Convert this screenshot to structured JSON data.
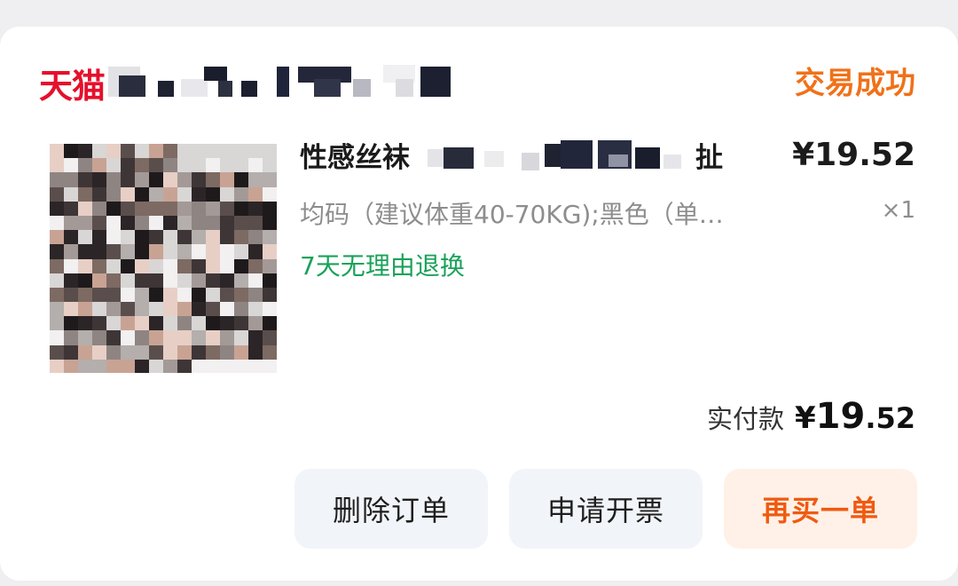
{
  "order": {
    "shop_brand": "天猫",
    "status": "交易成功",
    "item": {
      "title_start": "性感丝袜",
      "title_end": "扯",
      "price": "¥19.52",
      "spec": "均码（建议体重40-70KG);黑色（单…",
      "quantity": "×1",
      "service_tag": "7天无理由退换"
    },
    "payment": {
      "label": "实付款",
      "currency": "¥",
      "amount_integer": "19",
      "amount_decimal": ".52"
    },
    "actions": {
      "delete_label": "删除订单",
      "invoice_label": "申请开票",
      "buy_again_label": "再买一单"
    }
  },
  "colors": {
    "brand_red": "#e5102c",
    "status_orange": "#f07119",
    "service_green": "#1aa25a",
    "buy_again_text": "#f05a10",
    "buy_again_bg": "#fff1e7"
  }
}
